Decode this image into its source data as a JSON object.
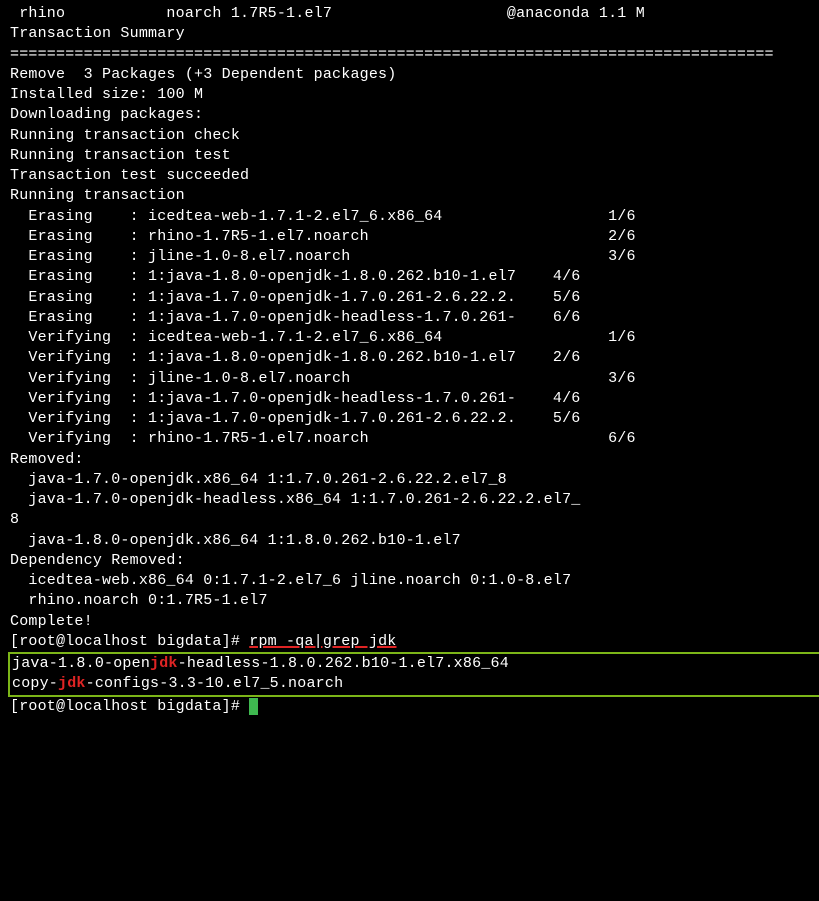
{
  "lines": {
    "l0": " rhino           noarch 1.7R5-1.el7                   @anaconda 1.1 M",
    "l1": "",
    "l2": "Transaction Summary",
    "l3": "===================================================================================",
    "l4": "Remove  3 Packages (+3 Dependent packages)",
    "l5": "",
    "l6": "Installed size: 100 M",
    "l7": "Downloading packages:",
    "l8": "Running transaction check",
    "l9": "Running transaction test",
    "l10": "Transaction test succeeded",
    "l11": "Running transaction",
    "l12": "  Erasing    : icedtea-web-1.7.1-2.el7_6.x86_64                  1/6",
    "l13": "  Erasing    : rhino-1.7R5-1.el7.noarch                          2/6",
    "l14": "  Erasing    : jline-1.0-8.el7.noarch                            3/6",
    "l15": "  Erasing    : 1:java-1.8.0-openjdk-1.8.0.262.b10-1.el7    4/6",
    "l16": "  Erasing    : 1:java-1.7.0-openjdk-1.7.0.261-2.6.22.2.    5/6",
    "l17": "  Erasing    : 1:java-1.7.0-openjdk-headless-1.7.0.261-    6/6",
    "l18": "  Verifying  : icedtea-web-1.7.1-2.el7_6.x86_64                  1/6",
    "l19": "  Verifying  : 1:java-1.8.0-openjdk-1.8.0.262.b10-1.el7    2/6",
    "l20": "  Verifying  : jline-1.0-8.el7.noarch                            3/6",
    "l21": "  Verifying  : 1:java-1.7.0-openjdk-headless-1.7.0.261-    4/6",
    "l22": "  Verifying  : 1:java-1.7.0-openjdk-1.7.0.261-2.6.22.2.    5/6",
    "l23": "  Verifying  : rhino-1.7R5-1.el7.noarch                          6/6",
    "l24": "",
    "l25": "Removed:",
    "l26": "  java-1.7.0-openjdk.x86_64 1:1.7.0.261-2.6.22.2.el7_8",
    "l27": "  java-1.7.0-openjdk-headless.x86_64 1:1.7.0.261-2.6.22.2.el7_",
    "l28": "8",
    "l29": "  java-1.8.0-openjdk.x86_64 1:1.8.0.262.b10-1.el7",
    "l30": "",
    "l31": "Dependency Removed:",
    "l32": "  icedtea-web.x86_64 0:1.7.1-2.el7_6 jline.noarch 0:1.0-8.el7",
    "l33": "  rhino.noarch 0:1.7R5-1.el7",
    "l34": "",
    "l35": "Complete!",
    "prompt1_pre": "[root@localhost bigdata]# ",
    "cmd1": "rpm -qa|grep jdk",
    "g1_pre": "java-1.8.0-open",
    "g1_hi": "jdk",
    "g1_post": "-headless-1.8.0.262.b10-1.el7.x86_64",
    "g2_pre": "copy-",
    "g2_hi": "jdk",
    "g2_post": "-configs-3.3-10.el7_5.noarch",
    "prompt2": "[root@localhost bigdata]# "
  }
}
